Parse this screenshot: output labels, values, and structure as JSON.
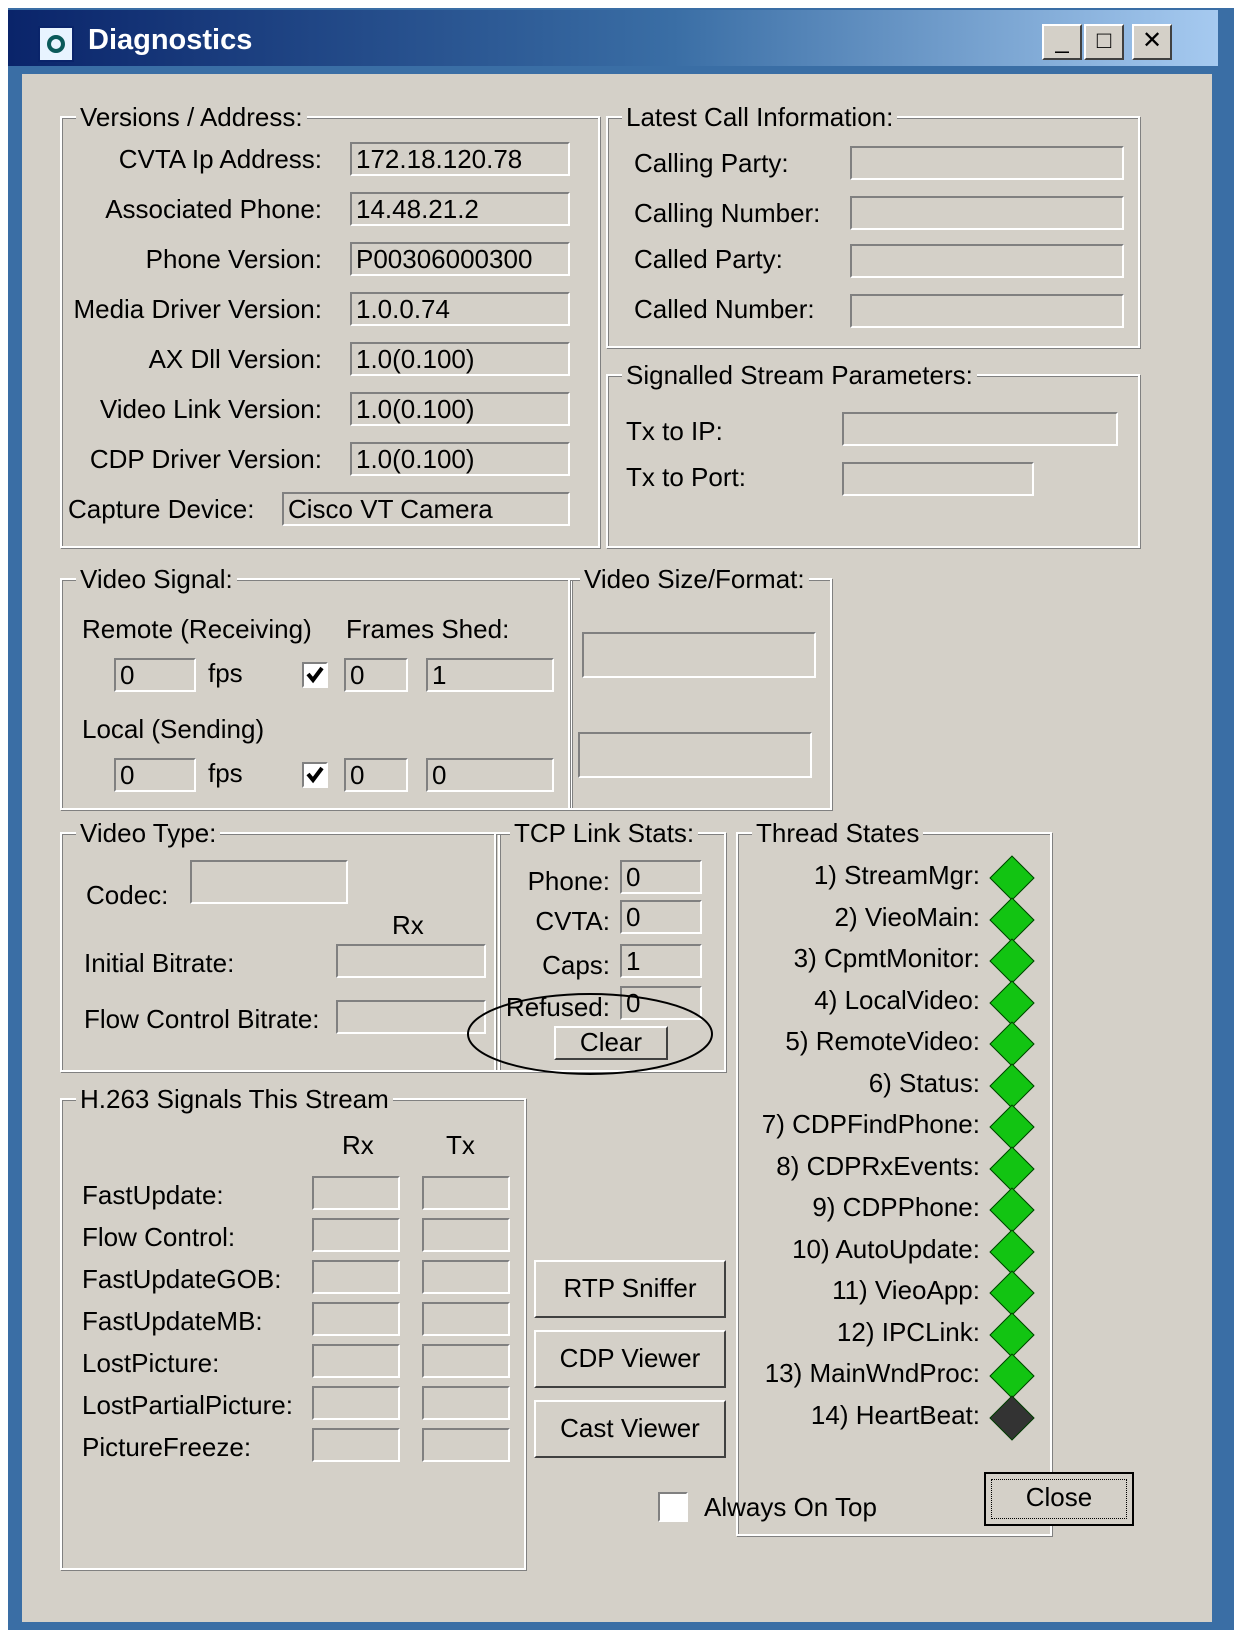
{
  "window": {
    "title": "Diagnostics"
  },
  "versions": {
    "title": "Versions / Address:",
    "items": [
      {
        "label": "CVTA Ip Address:",
        "value": "172.18.120.78"
      },
      {
        "label": "Associated Phone:",
        "value": "14.48.21.2"
      },
      {
        "label": "Phone Version:",
        "value": "P00306000300"
      },
      {
        "label": "Media Driver Version:",
        "value": "1.0.0.74"
      },
      {
        "label": "AX Dll Version:",
        "value": "1.0(0.100)"
      },
      {
        "label": "Video Link Version:",
        "value": "1.0(0.100)"
      },
      {
        "label": "CDP Driver Version:",
        "value": "1.0(0.100)"
      }
    ],
    "capture_label": "Capture Device:",
    "capture_value": "Cisco VT Camera"
  },
  "latest_call": {
    "title": "Latest Call Information:",
    "items": [
      {
        "label": "Calling Party:",
        "value": ""
      },
      {
        "label": "Calling Number:",
        "value": ""
      },
      {
        "label": "Called Party:",
        "value": ""
      },
      {
        "label": "Called Number:",
        "value": ""
      }
    ]
  },
  "signalled": {
    "title": "Signalled Stream Parameters:",
    "tx_ip_label": "Tx to IP:",
    "tx_ip_value": "",
    "tx_port_label": "Tx to Port:",
    "tx_port_value": ""
  },
  "video_signal": {
    "title": "Video Signal:",
    "remote_label": "Remote (Receiving)",
    "frames_shed_label": "Frames Shed:",
    "fps_label": "fps",
    "remote_fps": "0",
    "remote_checked": true,
    "remote_shed": "0",
    "remote_extra": "1",
    "local_label": "Local (Sending)",
    "local_fps": "0",
    "local_checked": true,
    "local_shed": "0",
    "local_extra": "0"
  },
  "video_size": {
    "title": "Video Size/Format:",
    "value1": "",
    "value2": ""
  },
  "video_type": {
    "title": "Video Type:",
    "codec_label": "Codec:",
    "codec_value": "",
    "rx_label": "Rx",
    "initial_label": "Initial Bitrate:",
    "initial_value": "",
    "flow_label": "Flow Control Bitrate:",
    "flow_value": ""
  },
  "tcp": {
    "title": "TCP Link Stats:",
    "phone_label": "Phone:",
    "phone_value": "0",
    "cvta_label": "CVTA:",
    "cvta_value": "0",
    "caps_label": "Caps:",
    "caps_value": "1",
    "refused_label": "Refused:",
    "refused_value": "0",
    "clear_label": "Clear"
  },
  "threads": {
    "title": "Thread States",
    "items": [
      {
        "label": "1) StreamMgr:",
        "state": "ok"
      },
      {
        "label": "2) VieoMain:",
        "state": "ok"
      },
      {
        "label": "3) CpmtMonitor:",
        "state": "ok"
      },
      {
        "label": "4) LocalVideo:",
        "state": "ok"
      },
      {
        "label": "5) RemoteVideo:",
        "state": "ok"
      },
      {
        "label": "6) Status:",
        "state": "ok"
      },
      {
        "label": "7) CDPFindPhone:",
        "state": "ok"
      },
      {
        "label": "8) CDPRxEvents:",
        "state": "ok"
      },
      {
        "label": "9) CDPPhone:",
        "state": "ok"
      },
      {
        "label": "10) AutoUpdate:",
        "state": "ok"
      },
      {
        "label": "11) VieoApp:",
        "state": "ok"
      },
      {
        "label": "12) IPCLink:",
        "state": "ok"
      },
      {
        "label": "13) MainWndProc:",
        "state": "ok"
      },
      {
        "label": "14) HeartBeat:",
        "state": "inactive"
      }
    ],
    "colors": {
      "ok": "#12c412",
      "inactive": "#333333"
    }
  },
  "h263": {
    "title": "H.263 Signals This Stream",
    "rx_label": "Rx",
    "tx_label": "Tx",
    "rows": [
      "FastUpdate:",
      "Flow Control:",
      "FastUpdateGOB:",
      "FastUpdateMB:",
      "LostPicture:",
      "LostPartialPicture:",
      "PictureFreeze:"
    ]
  },
  "buttons": {
    "rtp": "RTP Sniffer",
    "cdp": "CDP Viewer",
    "cast": "Cast Viewer",
    "close": "Close"
  },
  "always_on_top": {
    "label": "Always On Top",
    "checked": false
  }
}
